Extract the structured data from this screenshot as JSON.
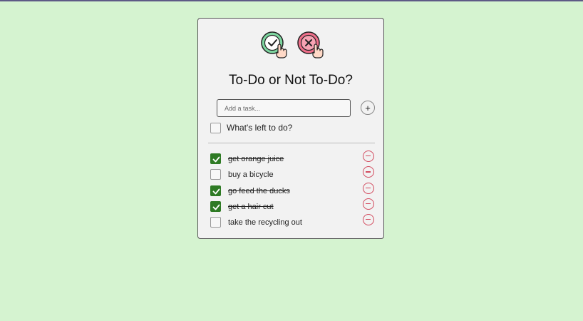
{
  "app": {
    "title": "To-Do or Not To-Do?"
  },
  "colors": {
    "background": "#d5f3d0",
    "card": "#f2f2f2",
    "checked": "#2e7a24",
    "remove": "#d24a5e",
    "topbar": "#5e5a86"
  },
  "input": {
    "placeholder": "Add a task...",
    "value": ""
  },
  "add_button": {
    "label": "+"
  },
  "toggle_all": {
    "label": "What's left to do?"
  },
  "tasks": [
    {
      "label": "get orange juice",
      "done": true
    },
    {
      "label": "buy a bicycle",
      "done": false
    },
    {
      "label": "go feed the ducks",
      "done": true
    },
    {
      "label": "get a hair cut",
      "done": true
    },
    {
      "label": "take the recycling out",
      "done": false
    }
  ]
}
